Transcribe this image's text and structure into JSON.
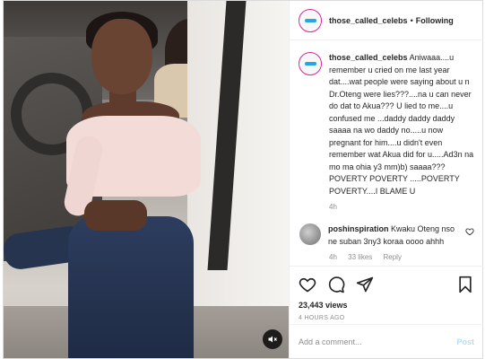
{
  "post": {
    "username": "those_called_celebs",
    "separator": "•",
    "follow_label": "Following"
  },
  "caption": {
    "username": "those_called_celebs",
    "text": "Aniwaaa....u remember u cried on me last year dat....wat people were saying about u n Dr.Oteng were lies???....na u can never do dat to Akua??? U lied to me....u confused me ...daddy daddy daddy saaaa na wo daddy no.....u now pregnant for him....u didn't even remember wat Akua did for u.....Ad3n na mo ma ohia y3 mm)b) saaaa??? POVERTY POVERTY .....POVERTY POVERTY....I BLAME U",
    "time": "4h"
  },
  "comment": {
    "username": "poshinspiration",
    "text": "Kwaku Oteng nso ne suban 3ny3 koraa oooo ahhh",
    "time": "4h",
    "likes": "33 likes",
    "reply": "Reply"
  },
  "stats": {
    "views": "23,443 views",
    "posted": "4 HOURS AGO"
  },
  "add_comment": {
    "placeholder": "Add a comment...",
    "post_label": "Post"
  },
  "icons": {
    "mute": "speaker-muted-icon",
    "like": "heart-icon",
    "comment": "comment-bubble-icon",
    "share": "paper-plane-icon",
    "save": "bookmark-icon"
  },
  "colors": {
    "link_post": "#b2dffc",
    "secondary_text": "#8e8e8e",
    "avatar_ring": "#d6249f",
    "logo": "#22a7e0"
  }
}
